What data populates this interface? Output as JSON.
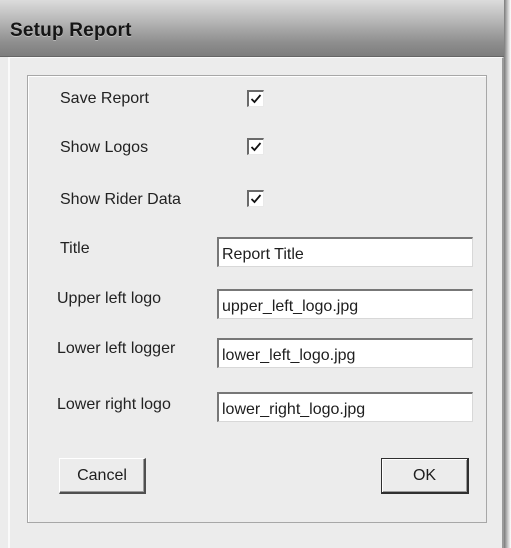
{
  "window": {
    "title": "Setup Report"
  },
  "checkboxes": [
    {
      "label": "Save Report",
      "checked": true
    },
    {
      "label": "Show Logos",
      "checked": true
    },
    {
      "label": "Show Rider Data",
      "checked": true
    }
  ],
  "fields": [
    {
      "label": "Title",
      "value": "Report Title"
    },
    {
      "label": "Upper left logo",
      "value": "upper_left_logo.jpg"
    },
    {
      "label": "Lower left logger",
      "value": "lower_left_logo.jpg"
    },
    {
      "label": "Lower right logo",
      "value": "lower_right_logo.jpg"
    }
  ],
  "buttons": {
    "cancel_label": "Cancel",
    "ok_label": "OK"
  }
}
